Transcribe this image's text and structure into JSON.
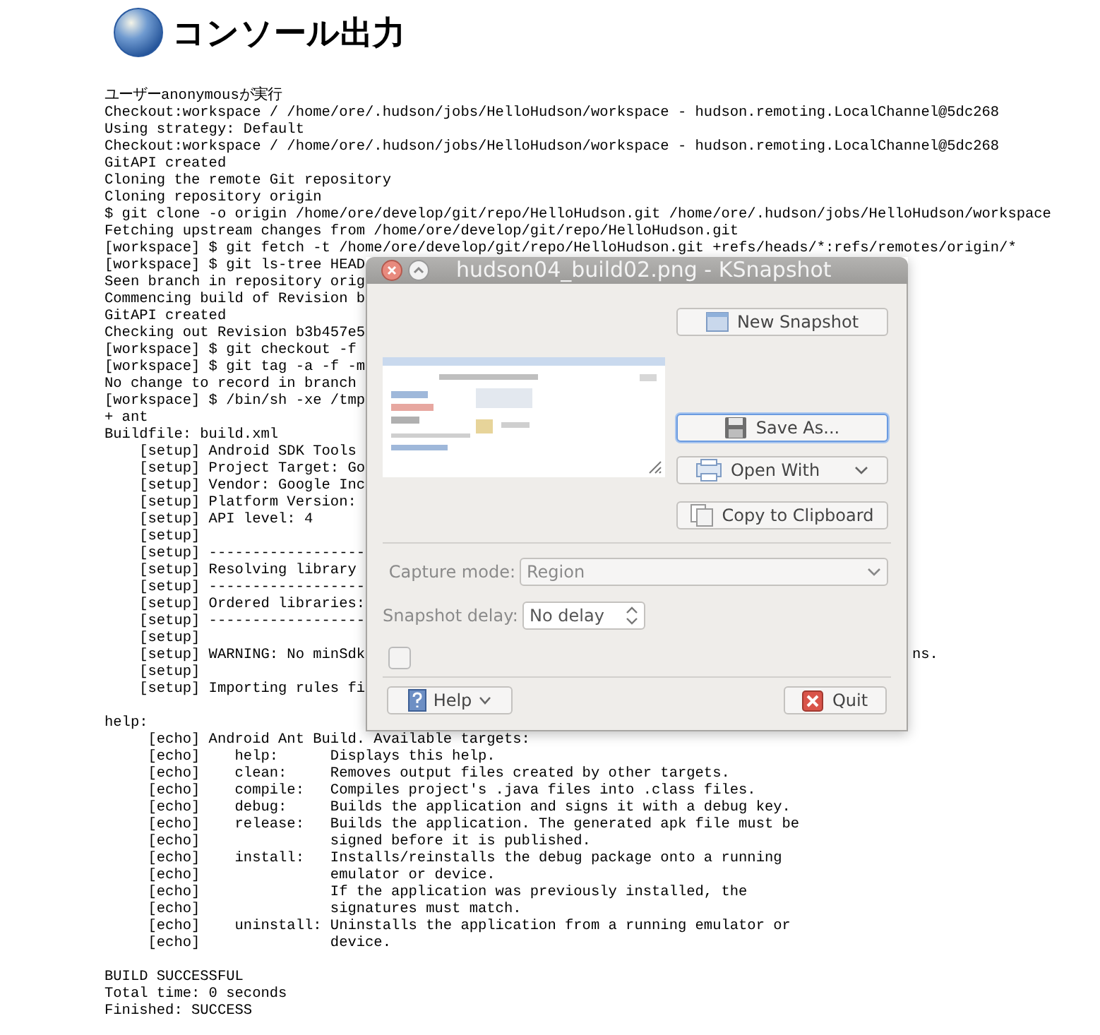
{
  "page_title": "コンソール出力",
  "console_blocks": [
    [
      "ユーザーanonymousが実行",
      "Checkout:workspace / /home/ore/.hudson/jobs/HelloHudson/workspace - hudson.remoting.LocalChannel@5dc268",
      "Using strategy: Default",
      "Checkout:workspace / /home/ore/.hudson/jobs/HelloHudson/workspace - hudson.remoting.LocalChannel@5dc268",
      "GitAPI created",
      "Cloning the remote Git repository",
      "Cloning repository origin",
      "$ git clone -o origin /home/ore/develop/git/repo/HelloHudson.git /home/ore/.hudson/jobs/HelloHudson/workspace",
      "Fetching upstream changes from /home/ore/develop/git/repo/HelloHudson.git",
      "[workspace] $ git fetch -t /home/ore/develop/git/repo/HelloHudson.git +refs/heads/*:refs/remotes/origin/*",
      "[workspace] $ git ls-tree HEAD",
      "Seen branch in repository orig",
      "Commencing build of Revision b",
      "GitAPI created",
      "Checking out Revision b3b457e5",
      "[workspace] $ git checkout -f",
      "[workspace] $ git tag -a -f -m",
      "No change to record in branch",
      "[workspace] $ /bin/sh -xe /tmp",
      "+ ant",
      "Buildfile: build.xml",
      "    [setup] Android SDK Tools",
      "    [setup] Project Target: Go",
      "    [setup] Vendor: Google Inc",
      "    [setup] Platform Version:",
      "    [setup] API level: 4",
      "    [setup]",
      "    [setup] ------------------",
      "    [setup] Resolving library",
      "    [setup] ------------------",
      "    [setup] Ordered libraries:",
      "    [setup] ------------------",
      "    [setup]",
      {
        "text": "    [setup] WARNING: No minSdk",
        "tail": "ns."
      },
      "    [setup]",
      "    [setup] Importing rules fi"
    ],
    [
      "help:",
      "     [echo] Android Ant Build. Available targets:",
      "     [echo]    help:      Displays this help.",
      "     [echo]    clean:     Removes output files created by other targets.",
      "     [echo]    compile:   Compiles project's .java files into .class files.",
      "     [echo]    debug:     Builds the application and signs it with a debug key.",
      "     [echo]    release:   Builds the application. The generated apk file must be",
      "     [echo]               signed before it is published.",
      "     [echo]    install:   Installs/reinstalls the debug package onto a running",
      "     [echo]               emulator or device.",
      "     [echo]               If the application was previously installed, the",
      "     [echo]               signatures must match.",
      "     [echo]    uninstall: Uninstalls the application from a running emulator or",
      "     [echo]               device."
    ],
    [
      "BUILD SUCCESSFUL",
      "Total time: 0 seconds",
      "Finished: SUCCESS"
    ]
  ],
  "dialog": {
    "title": "hudson04_build02.png - KSnapshot",
    "buttons": [
      {
        "label": "New Snapshot",
        "kind": "new",
        "focused": false
      },
      {
        "label": "Save As...",
        "kind": "save",
        "focused": true
      },
      {
        "label": "Open With",
        "kind": "open",
        "focused": false
      },
      {
        "label": "Copy to Clipboard",
        "kind": "copy",
        "focused": false
      }
    ],
    "capture_mode": {
      "label": "Capture mode:",
      "value": "Region"
    },
    "snapshot_delay": {
      "label": "Snapshot delay:",
      "value": "No delay"
    },
    "checkbox": {
      "checked": false
    },
    "help_button": "Help",
    "quit_button": "Quit"
  }
}
